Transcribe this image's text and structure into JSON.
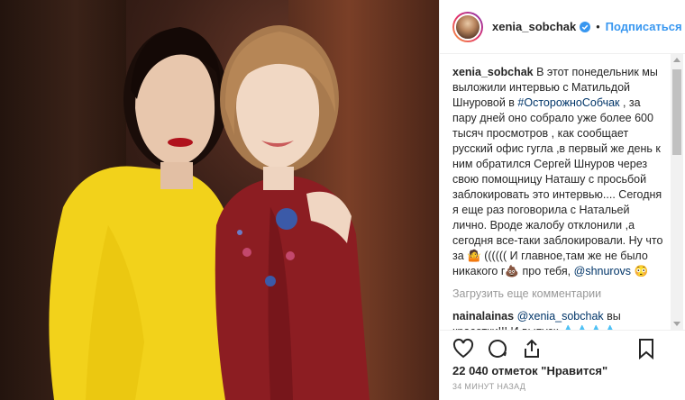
{
  "header": {
    "username": "xenia_sobchak",
    "follow_label": "Подписаться",
    "dot": "•"
  },
  "caption": {
    "author": "xenia_sobchak",
    "text_1": "В этот понедельник мы выложили интервью с Матильдой Шнуровой в ",
    "hashtag": "#ОсторожноСобчак",
    "text_2": " , за пару дней оно собрало уже более 600 тысяч просмотров , как сообщает русский офис гугла ,в первый же день к ним обратился Сергей Шнуров через свою помощницу Наташу с просьбой заблокировать это интервью.... Сегодня я еще раз поговорила с Натальей лично. Вроде жалобу отклонили ,а сегодня все-таки заблокировали. Ну что за ",
    "emoji_1": "🤷",
    "text_3": " (((((( И главное,там же не было никакого г",
    "emoji_2": "💩",
    "text_4": " про тебя, ",
    "mention": "@shnurovs",
    "emoji_3": "😳"
  },
  "load_more": "Загрузить еще комментарии",
  "comment": {
    "author": "nainalainas",
    "mention": "@xenia_sobchak",
    "text": " вы красотки!!! И выпуск 💧💧💧💧, смотрела с удовольствием! Матильда восхитительная женщина! 🌼🌼🌼и будьте счастливы!😊"
  },
  "likes": "22 040 отметок \"Нравится\"",
  "time": "34 МИНУТ НАЗАД",
  "colors": {
    "link": "#3897f0",
    "hashtag": "#003569",
    "meta": "#999999"
  },
  "icons": [
    "heart-icon",
    "comment-icon",
    "share-icon",
    "bookmark-icon",
    "verified-icon"
  ]
}
